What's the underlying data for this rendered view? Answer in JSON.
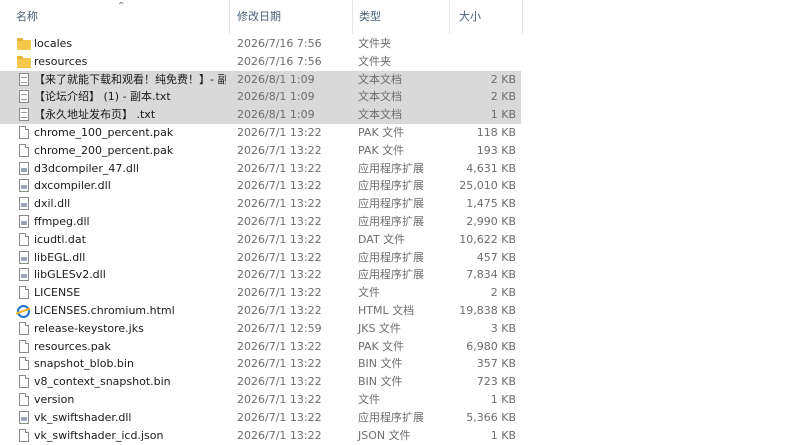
{
  "columns": {
    "name": "名称",
    "date": "修改日期",
    "type": "类型",
    "size": "大小"
  },
  "files": [
    {
      "name": "locales",
      "date": "2026/7/16 7:56",
      "type": "文件夹",
      "size": "",
      "icon": "folder-icon",
      "selected": false
    },
    {
      "name": "resources",
      "date": "2026/7/16 7:56",
      "type": "文件夹",
      "size": "",
      "icon": "folder-icon",
      "selected": false
    },
    {
      "name": "【来了就能下载和观看！纯免费！】- 副...",
      "date": "2026/8/1 1:09",
      "type": "文本文档",
      "size": "2 KB",
      "icon": "text-file-icon",
      "selected": true
    },
    {
      "name": "【论坛介绍】 (1) - 副本.txt",
      "date": "2026/8/1 1:09",
      "type": "文本文档",
      "size": "2 KB",
      "icon": "text-file-icon",
      "selected": true
    },
    {
      "name": "【永久地址发布页】 .txt",
      "date": "2026/8/1 1:09",
      "type": "文本文档",
      "size": "1 KB",
      "icon": "text-file-icon",
      "selected": true
    },
    {
      "name": "chrome_100_percent.pak",
      "date": "2026/7/1 13:22",
      "type": "PAK 文件",
      "size": "118 KB",
      "icon": "file-icon",
      "selected": false
    },
    {
      "name": "chrome_200_percent.pak",
      "date": "2026/7/1 13:22",
      "type": "PAK 文件",
      "size": "193 KB",
      "icon": "file-icon",
      "selected": false
    },
    {
      "name": "d3dcompiler_47.dll",
      "date": "2026/7/1 13:22",
      "type": "应用程序扩展",
      "size": "4,631 KB",
      "icon": "dll-icon",
      "selected": false
    },
    {
      "name": "dxcompiler.dll",
      "date": "2026/7/1 13:22",
      "type": "应用程序扩展",
      "size": "25,010 KB",
      "icon": "dll-icon",
      "selected": false
    },
    {
      "name": "dxil.dll",
      "date": "2026/7/1 13:22",
      "type": "应用程序扩展",
      "size": "1,475 KB",
      "icon": "dll-icon",
      "selected": false
    },
    {
      "name": "ffmpeg.dll",
      "date": "2026/7/1 13:22",
      "type": "应用程序扩展",
      "size": "2,990 KB",
      "icon": "dll-icon",
      "selected": false
    },
    {
      "name": "icudtl.dat",
      "date": "2026/7/1 13:22",
      "type": "DAT 文件",
      "size": "10,622 KB",
      "icon": "file-icon",
      "selected": false
    },
    {
      "name": "libEGL.dll",
      "date": "2026/7/1 13:22",
      "type": "应用程序扩展",
      "size": "457 KB",
      "icon": "dll-icon",
      "selected": false
    },
    {
      "name": "libGLESv2.dll",
      "date": "2026/7/1 13:22",
      "type": "应用程序扩展",
      "size": "7,834 KB",
      "icon": "dll-icon",
      "selected": false
    },
    {
      "name": "LICENSE",
      "date": "2026/7/1 13:22",
      "type": "文件",
      "size": "2 KB",
      "icon": "file-icon",
      "selected": false
    },
    {
      "name": "LICENSES.chromium.html",
      "date": "2026/7/1 13:22",
      "type": "HTML 文档",
      "size": "19,838 KB",
      "icon": "html-icon",
      "selected": false
    },
    {
      "name": "release-keystore.jks",
      "date": "2026/7/1 12:59",
      "type": "JKS 文件",
      "size": "3 KB",
      "icon": "file-icon",
      "selected": false
    },
    {
      "name": "resources.pak",
      "date": "2026/7/1 13:22",
      "type": "PAK 文件",
      "size": "6,980 KB",
      "icon": "file-icon",
      "selected": false
    },
    {
      "name": "snapshot_blob.bin",
      "date": "2026/7/1 13:22",
      "type": "BIN 文件",
      "size": "357 KB",
      "icon": "file-icon",
      "selected": false
    },
    {
      "name": "v8_context_snapshot.bin",
      "date": "2026/7/1 13:22",
      "type": "BIN 文件",
      "size": "723 KB",
      "icon": "file-icon",
      "selected": false
    },
    {
      "name": "version",
      "date": "2026/7/1 13:22",
      "type": "文件",
      "size": "1 KB",
      "icon": "file-icon",
      "selected": false
    },
    {
      "name": "vk_swiftshader.dll",
      "date": "2026/7/1 13:22",
      "type": "应用程序扩展",
      "size": "5,366 KB",
      "icon": "dll-icon",
      "selected": false
    },
    {
      "name": "vk_swiftshader_icd.json",
      "date": "2026/7/1 13:22",
      "type": "JSON 文件",
      "size": "1 KB",
      "icon": "file-icon",
      "selected": false
    }
  ]
}
